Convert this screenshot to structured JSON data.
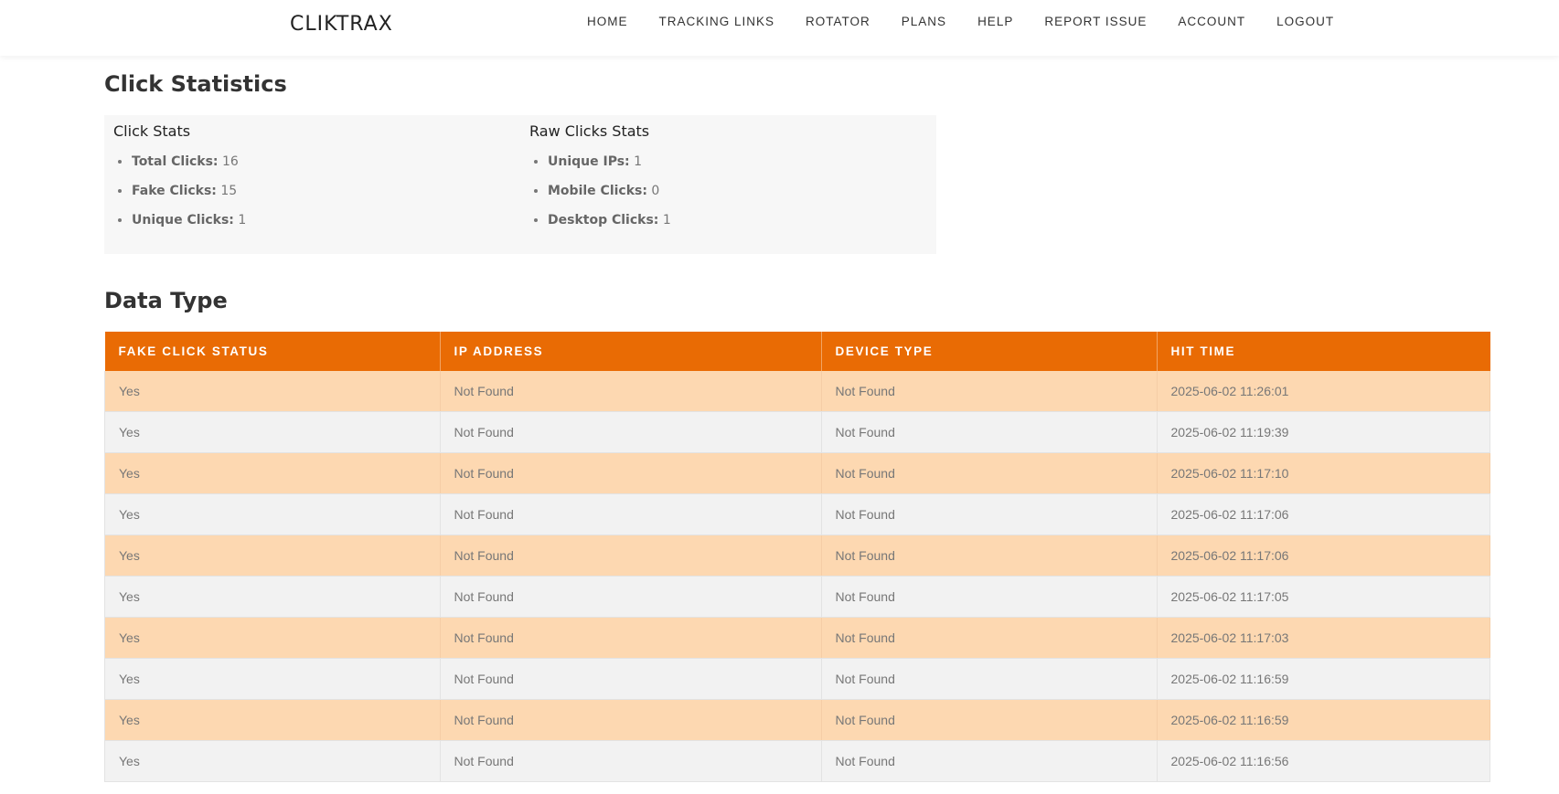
{
  "brand": "CLIKTRAX",
  "nav": [
    "HOME",
    "TRACKING LINKS",
    "ROTATOR",
    "PLANS",
    "HELP",
    "REPORT ISSUE",
    "ACCOUNT",
    "LOGOUT"
  ],
  "page_title": "Click Statistics",
  "click_stats": {
    "heading": "Click Stats",
    "items": [
      {
        "label": "Total Clicks:",
        "value": "16"
      },
      {
        "label": "Fake Clicks:",
        "value": "15"
      },
      {
        "label": "Unique Clicks:",
        "value": "1"
      }
    ]
  },
  "raw_stats": {
    "heading": "Raw Clicks Stats",
    "items": [
      {
        "label": "Unique IPs:",
        "value": "1"
      },
      {
        "label": "Mobile Clicks:",
        "value": "0"
      },
      {
        "label": "Desktop Clicks:",
        "value": "1"
      }
    ]
  },
  "data_title": "Data Type",
  "table": {
    "headers": [
      "FAKE CLICK STATUS",
      "IP ADDRESS",
      "DEVICE TYPE",
      "HIT TIME"
    ],
    "rows": [
      [
        "Yes",
        "Not Found",
        "Not Found",
        "2025-06-02 11:26:01"
      ],
      [
        "Yes",
        "Not Found",
        "Not Found",
        "2025-06-02 11:19:39"
      ],
      [
        "Yes",
        "Not Found",
        "Not Found",
        "2025-06-02 11:17:10"
      ],
      [
        "Yes",
        "Not Found",
        "Not Found",
        "2025-06-02 11:17:06"
      ],
      [
        "Yes",
        "Not Found",
        "Not Found",
        "2025-06-02 11:17:06"
      ],
      [
        "Yes",
        "Not Found",
        "Not Found",
        "2025-06-02 11:17:05"
      ],
      [
        "Yes",
        "Not Found",
        "Not Found",
        "2025-06-02 11:17:03"
      ],
      [
        "Yes",
        "Not Found",
        "Not Found",
        "2025-06-02 11:16:59"
      ],
      [
        "Yes",
        "Not Found",
        "Not Found",
        "2025-06-02 11:16:59"
      ],
      [
        "Yes",
        "Not Found",
        "Not Found",
        "2025-06-02 11:16:56"
      ]
    ]
  },
  "colors": {
    "accent": "#e96b04",
    "row_alt": "#fdd8b1",
    "row": "#f2f2f2"
  }
}
